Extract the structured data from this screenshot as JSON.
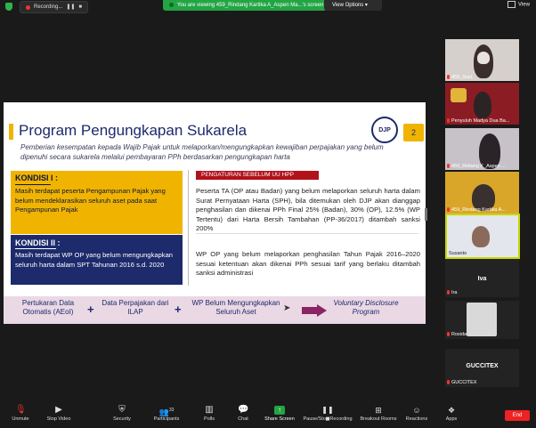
{
  "topbar": {
    "recording_label": "Recording...",
    "viewing_text": "You are viewing 459_Rindang Kartika A_Aspen Ma...'s screen",
    "view_options": "View Options",
    "view_button": "View"
  },
  "slide": {
    "title": "Program Pengungkapan Sukarela",
    "logo_text": "DJP",
    "page_number": "2",
    "intro": "Pemberian kesempatan kepada Wajib Pajak untuk melaporkan/mengungkapkan kewajiban perpajakan yang belum dipenuhi secara sukarela melalui pembayaran PPh berdasarkan pengungkapan harta",
    "kondisi1_title": "KONDISI I :",
    "kondisi1_text": "Masih terdapat peserta Pengampunan Pajak yang belum mendeklarasikan seluruh aset pada saat Pengampunan Pajak",
    "kondisi2_title": "KONDISI II :",
    "kondisi2_text": "Masih terdapat WP OP yang belum mengungkapkan seluruh harta dalam SPT Tahunan 2016 s.d. 2020",
    "pengaturan_header": "PENGATURAN SEBELUM UU HPP",
    "para1": "Peserta TA (OP atau Badan) yang belum melaporkan seluruh harta dalam Surat Pernyataan Harta (SPH), bila ditemukan oleh DJP akan dianggap penghasilan dan dikenai PPh Final 25% (Badan), 30% (OP), 12.5% (WP Tertentu) dari Harta Bersih Tambahan (PP-36/2017) ditambah sanksi 200%",
    "para2": "WP OP yang belum melaporkan penghasilan Tahun Pajak 2016–2020 sesuai ketentuan akan dikenai PPh sesuai tarif yang berlaku ditambah sanksi administrasi",
    "bottom_items": [
      "Pertukaran Data Otomatis (AEoI)",
      "Data Perpajakan dari ILAP",
      "WP Belum Mengungkapkan Seluruh Aset"
    ],
    "bottom_plus": "+",
    "bottom_result": "Voluntary Disclosure Program"
  },
  "participants": [
    {
      "name": "459_Suci"
    },
    {
      "name": "Penyuluh Madya Dua Ba..."
    },
    {
      "name": "459_Ridlang K_Aspen ..."
    },
    {
      "name": "459_Rindang Kartika A..."
    },
    {
      "name": "Susanto"
    },
    {
      "name": "Iva",
      "label": "Iva",
      "small": "Ira"
    },
    {
      "name": "Rosida",
      "small": "Rosida"
    },
    {
      "name": "GUCCITEX",
      "label": "GUCCITEX",
      "small": "GUCCITEX"
    }
  ],
  "toolbar": {
    "unmute": "Unmute",
    "stop_video": "Stop Video",
    "security": "Security",
    "participants": "Participants",
    "participants_count": "33",
    "polls": "Polls",
    "chat": "Chat",
    "share_screen": "Share Screen",
    "pause_recording": "Pause/Stop Recording",
    "breakout_rooms": "Breakout Rooms",
    "reactions": "Reactions",
    "apps": "Apps",
    "end": "End"
  },
  "colors": {
    "accent_yellow": "#f0b400",
    "navy": "#1d2a6b",
    "red_header": "#b1121b",
    "share_green": "#23a544",
    "end_red": "#e22"
  }
}
